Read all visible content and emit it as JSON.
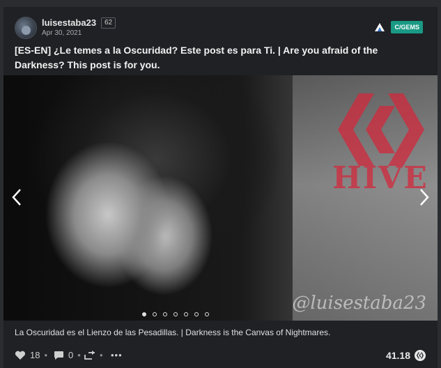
{
  "post": {
    "author": "luisestaba23",
    "reputation": "62",
    "date": "Apr 30, 2021",
    "community_tag": "C/GEMS",
    "title": "[ES-EN] ¿Le temes a la Oscuridad? Este post es para Ti. | Are you afraid of the Darkness? This post is for you.",
    "caption": "La Oscuridad es el Lienzo de las Pesadillas. | Darkness is the Canvas of Nightmares.",
    "image_text": {
      "brand": "HIVE",
      "watermark": "@luisestaba23"
    },
    "carousel": {
      "total": 7,
      "active_index": 0
    }
  },
  "footer": {
    "votes": "18",
    "comments": "0",
    "more": "•••",
    "payout": "41.18"
  },
  "icons": {
    "upvote": "heart-icon",
    "comment": "comment-icon",
    "reblog": "reblog-icon",
    "prev": "chevron-left-icon",
    "next": "chevron-right-icon",
    "community_logo": "ecency-logo-icon",
    "currency": "hive-coin-icon"
  },
  "colors": {
    "background": "#2a2c30",
    "card": "#1f2125",
    "tag": "#1a9a85",
    "hive_red": "#d2283c"
  }
}
